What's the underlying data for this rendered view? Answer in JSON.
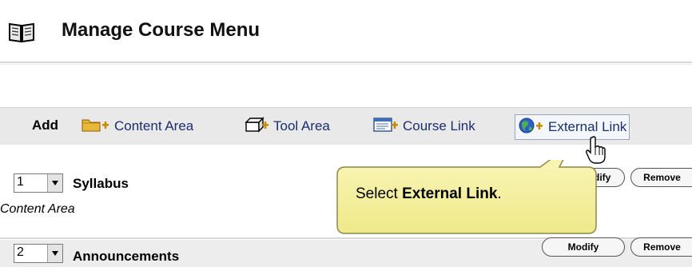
{
  "header": {
    "title": "Manage Course Menu"
  },
  "toolbar": {
    "add_label": "Add",
    "items": [
      {
        "label": "Content Area"
      },
      {
        "label": "Tool Area"
      },
      {
        "label": "Course Link"
      },
      {
        "label": "External Link"
      }
    ]
  },
  "menu_items": [
    {
      "order": "1",
      "title": "Syllabus",
      "type": "Content Area",
      "modify_label": "Modify",
      "remove_label": "Remove"
    },
    {
      "order": "2",
      "title": "Announcements",
      "modify_label": "Modify",
      "remove_label": "Remove"
    }
  ],
  "callout": {
    "prefix": "Select ",
    "bold": "External Link",
    "suffix": "."
  },
  "colors": {
    "toolbar_link": "#1a2e6e",
    "callout_fill": "#f7f3a4",
    "toolbar_bg": "#e9e9e9"
  }
}
